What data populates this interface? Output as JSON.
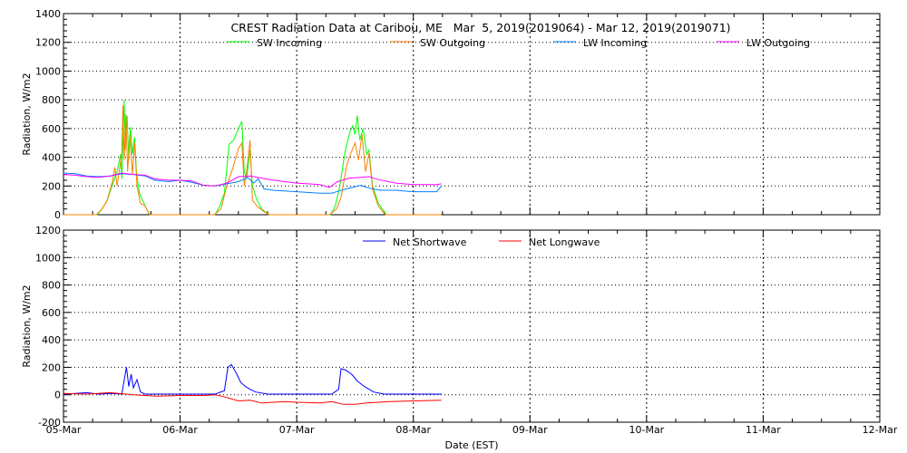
{
  "title": "CREST Radiation Data at Caribou, ME   Mar  5, 2019(2019064) - Mar 12, 2019(2019071)",
  "chart_data": [
    {
      "type": "line",
      "ylabel": "Radiation, W/m2",
      "xlabel": "",
      "ylim": [
        0,
        1400
      ],
      "yticks": [
        0,
        200,
        400,
        600,
        800,
        1000,
        1200,
        1400
      ],
      "xlim": [
        0,
        7
      ],
      "xticks": [
        "05-Mar",
        "06-Mar",
        "07-Mar",
        "08-Mar",
        "09-Mar",
        "10-Mar",
        "11-Mar",
        "12-Mar"
      ],
      "series": [
        {
          "name": "SW Incoming",
          "color": "#00ff00",
          "points": [
            [
              0,
              0
            ],
            [
              0.29,
              0
            ],
            [
              0.33,
              40
            ],
            [
              0.375,
              100
            ],
            [
              0.42,
              210
            ],
            [
              0.46,
              300
            ],
            [
              0.49,
              420
            ],
            [
              0.5,
              250
            ],
            [
              0.515,
              650
            ],
            [
              0.52,
              800
            ],
            [
              0.53,
              450
            ],
            [
              0.545,
              690
            ],
            [
              0.56,
              380
            ],
            [
              0.575,
              610
            ],
            [
              0.59,
              420
            ],
            [
              0.61,
              540
            ],
            [
              0.625,
              300
            ],
            [
              0.65,
              150
            ],
            [
              0.69,
              80
            ],
            [
              0.73,
              10
            ],
            [
              0.75,
              0
            ],
            [
              1.3,
              0
            ],
            [
              1.34,
              60
            ],
            [
              1.38,
              150
            ],
            [
              1.4,
              320
            ],
            [
              1.42,
              490
            ],
            [
              1.46,
              520
            ],
            [
              1.5,
              600
            ],
            [
              1.53,
              650
            ],
            [
              1.55,
              300
            ],
            [
              1.57,
              250
            ],
            [
              1.6,
              450
            ],
            [
              1.62,
              200
            ],
            [
              1.66,
              100
            ],
            [
              1.7,
              40
            ],
            [
              1.76,
              0
            ],
            [
              2.29,
              0
            ],
            [
              2.33,
              60
            ],
            [
              2.37,
              200
            ],
            [
              2.41,
              420
            ],
            [
              2.45,
              560
            ],
            [
              2.48,
              620
            ],
            [
              2.5,
              560
            ],
            [
              2.52,
              690
            ],
            [
              2.54,
              520
            ],
            [
              2.57,
              600
            ],
            [
              2.6,
              420
            ],
            [
              2.62,
              450
            ],
            [
              2.65,
              200
            ],
            [
              2.7,
              80
            ],
            [
              2.77,
              0
            ],
            [
              3.24,
              0
            ]
          ]
        },
        {
          "name": "SW Outgoing",
          "color": "#ff7f00",
          "points": [
            [
              0,
              0
            ],
            [
              0.28,
              0
            ],
            [
              0.32,
              30
            ],
            [
              0.37,
              90
            ],
            [
              0.42,
              230
            ],
            [
              0.44,
              330
            ],
            [
              0.46,
              200
            ],
            [
              0.5,
              430
            ],
            [
              0.51,
              760
            ],
            [
              0.52,
              380
            ],
            [
              0.535,
              700
            ],
            [
              0.55,
              300
            ],
            [
              0.57,
              560
            ],
            [
              0.59,
              280
            ],
            [
              0.61,
              500
            ],
            [
              0.63,
              200
            ],
            [
              0.66,
              80
            ],
            [
              0.7,
              60
            ],
            [
              0.74,
              0
            ],
            [
              1.29,
              0
            ],
            [
              1.35,
              40
            ],
            [
              1.4,
              200
            ],
            [
              1.45,
              320
            ],
            [
              1.5,
              460
            ],
            [
              1.53,
              500
            ],
            [
              1.55,
              200
            ],
            [
              1.57,
              300
            ],
            [
              1.6,
              520
            ],
            [
              1.62,
              100
            ],
            [
              1.66,
              60
            ],
            [
              1.72,
              20
            ],
            [
              1.77,
              0
            ],
            [
              2.28,
              0
            ],
            [
              2.34,
              40
            ],
            [
              2.38,
              120
            ],
            [
              2.43,
              350
            ],
            [
              2.47,
              440
            ],
            [
              2.5,
              500
            ],
            [
              2.53,
              380
            ],
            [
              2.56,
              560
            ],
            [
              2.59,
              300
            ],
            [
              2.62,
              430
            ],
            [
              2.65,
              180
            ],
            [
              2.7,
              60
            ],
            [
              2.76,
              0
            ],
            [
              3.24,
              0
            ]
          ]
        },
        {
          "name": "LW Incoming",
          "color": "#0080ff",
          "points": [
            [
              0,
              290
            ],
            [
              0.1,
              285
            ],
            [
              0.2,
              270
            ],
            [
              0.3,
              265
            ],
            [
              0.4,
              270
            ],
            [
              0.5,
              285
            ],
            [
              0.6,
              280
            ],
            [
              0.7,
              270
            ],
            [
              0.78,
              240
            ],
            [
              0.9,
              230
            ],
            [
              1.0,
              240
            ],
            [
              1.1,
              225
            ],
            [
              1.2,
              205
            ],
            [
              1.3,
              200
            ],
            [
              1.4,
              215
            ],
            [
              1.5,
              230
            ],
            [
              1.58,
              260
            ],
            [
              1.63,
              220
            ],
            [
              1.67,
              250
            ],
            [
              1.72,
              180
            ],
            [
              1.8,
              170
            ],
            [
              2.0,
              160
            ],
            [
              2.2,
              150
            ],
            [
              2.3,
              150
            ],
            [
              2.4,
              175
            ],
            [
              2.5,
              195
            ],
            [
              2.55,
              205
            ],
            [
              2.62,
              185
            ],
            [
              2.72,
              170
            ],
            [
              2.85,
              170
            ],
            [
              3.0,
              160
            ],
            [
              3.2,
              160
            ],
            [
              3.24,
              200
            ]
          ]
        },
        {
          "name": "LW Outgoing",
          "color": "#ff00ff",
          "points": [
            [
              0,
              280
            ],
            [
              0.1,
              275
            ],
            [
              0.2,
              265
            ],
            [
              0.3,
              260
            ],
            [
              0.4,
              270
            ],
            [
              0.5,
              290
            ],
            [
              0.6,
              280
            ],
            [
              0.7,
              275
            ],
            [
              0.78,
              250
            ],
            [
              0.9,
              240
            ],
            [
              1.0,
              240
            ],
            [
              1.1,
              235
            ],
            [
              1.2,
              205
            ],
            [
              1.3,
              200
            ],
            [
              1.4,
              220
            ],
            [
              1.5,
              265
            ],
            [
              1.6,
              270
            ],
            [
              1.7,
              255
            ],
            [
              1.8,
              240
            ],
            [
              1.9,
              230
            ],
            [
              2.0,
              220
            ],
            [
              2.1,
              215
            ],
            [
              2.2,
              210
            ],
            [
              2.28,
              190
            ],
            [
              2.35,
              230
            ],
            [
              2.45,
              255
            ],
            [
              2.55,
              260
            ],
            [
              2.62,
              265
            ],
            [
              2.7,
              245
            ],
            [
              2.85,
              220
            ],
            [
              3.0,
              210
            ],
            [
              3.2,
              210
            ],
            [
              3.24,
              215
            ]
          ]
        }
      ]
    },
    {
      "type": "line",
      "ylabel": "Radiation, W/m2",
      "xlabel": "Date (EST)",
      "ylim": [
        -200,
        1200
      ],
      "yticks": [
        -200,
        0,
        200,
        400,
        600,
        800,
        1000,
        1200
      ],
      "xlim": [
        0,
        7
      ],
      "xticks": [
        "05-Mar",
        "06-Mar",
        "07-Mar",
        "08-Mar",
        "09-Mar",
        "10-Mar",
        "11-Mar",
        "12-Mar"
      ],
      "series": [
        {
          "name": "Net Shortwave",
          "color": "#0000ff",
          "points": [
            [
              0,
              5
            ],
            [
              0.1,
              10
            ],
            [
              0.2,
              15
            ],
            [
              0.3,
              5
            ],
            [
              0.4,
              10
            ],
            [
              0.5,
              5
            ],
            [
              0.54,
              200
            ],
            [
              0.56,
              60
            ],
            [
              0.58,
              150
            ],
            [
              0.6,
              50
            ],
            [
              0.63,
              110
            ],
            [
              0.66,
              20
            ],
            [
              0.7,
              5
            ],
            [
              1.0,
              5
            ],
            [
              1.3,
              5
            ],
            [
              1.38,
              30
            ],
            [
              1.41,
              200
            ],
            [
              1.44,
              220
            ],
            [
              1.48,
              160
            ],
            [
              1.52,
              90
            ],
            [
              1.56,
              60
            ],
            [
              1.6,
              40
            ],
            [
              1.65,
              20
            ],
            [
              1.75,
              5
            ],
            [
              2.3,
              5
            ],
            [
              2.36,
              40
            ],
            [
              2.38,
              190
            ],
            [
              2.42,
              180
            ],
            [
              2.47,
              150
            ],
            [
              2.52,
              100
            ],
            [
              2.58,
              60
            ],
            [
              2.66,
              20
            ],
            [
              2.75,
              5
            ],
            [
              3.24,
              5
            ]
          ]
        },
        {
          "name": "Net Longwave",
          "color": "#ff0000",
          "points": [
            [
              0,
              10
            ],
            [
              0.2,
              5
            ],
            [
              0.4,
              15
            ],
            [
              0.6,
              0
            ],
            [
              0.8,
              -10
            ],
            [
              1.0,
              -5
            ],
            [
              1.2,
              -5
            ],
            [
              1.3,
              0
            ],
            [
              1.4,
              -20
            ],
            [
              1.5,
              -45
            ],
            [
              1.6,
              -40
            ],
            [
              1.7,
              -60
            ],
            [
              1.8,
              -55
            ],
            [
              1.9,
              -50
            ],
            [
              2.0,
              -55
            ],
            [
              2.2,
              -60
            ],
            [
              2.3,
              -50
            ],
            [
              2.4,
              -70
            ],
            [
              2.5,
              -70
            ],
            [
              2.6,
              -60
            ],
            [
              2.8,
              -50
            ],
            [
              3.0,
              -45
            ],
            [
              3.24,
              -40
            ]
          ]
        }
      ]
    }
  ]
}
